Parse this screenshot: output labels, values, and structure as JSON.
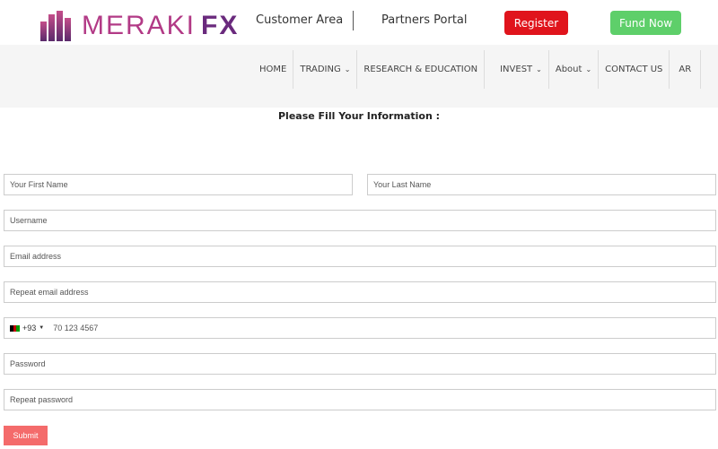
{
  "header": {
    "logo": {
      "word1": "MERAKI",
      "word2": "FX"
    },
    "customer_area": "Customer Area",
    "partners_portal": "Partners Portal",
    "register": "Register",
    "fund_now": "Fund Now",
    "colors": {
      "register": "#e0141c",
      "fund_now": "#5ecf6a",
      "brand": "#b23a86"
    }
  },
  "nav": {
    "items": [
      {
        "label": "HOME",
        "dropdown": false
      },
      {
        "label": "TRADING",
        "dropdown": true
      },
      {
        "label": "RESEARCH & EDUCATION",
        "dropdown": false
      },
      {
        "label": "INVEST",
        "dropdown": true
      },
      {
        "label": "About",
        "dropdown": true
      },
      {
        "label": "CONTACT US",
        "dropdown": false
      },
      {
        "label": "AR",
        "dropdown": false
      }
    ]
  },
  "form": {
    "title": "Please Fill Your Information :",
    "first_name": "Your First Name",
    "last_name": "Your Last Name",
    "username": "Username",
    "email": "Email address",
    "repeat_email": "Repeat email address",
    "phone": {
      "code": "+93",
      "placeholder": "70 123 4567",
      "flag_icon": "afghanistan-flag-icon"
    },
    "password": "Password",
    "repeat_password": "Repeat password",
    "submit": "Submit"
  }
}
